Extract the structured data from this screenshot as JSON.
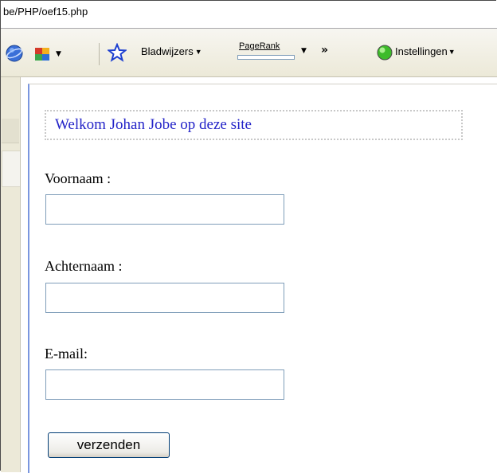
{
  "address_bar": {
    "url": "be/PHP/oef15.php"
  },
  "toolbar": {
    "bookmarks_label": "Bladwijzers",
    "pagerank_label": "PageRank",
    "more_label": "»",
    "settings_label": "Instellingen",
    "dropdown_glyph": "▼"
  },
  "form": {
    "welcome_text": "Welkom Johan Jobe op deze site",
    "first_name_label": "Voornaam :",
    "first_name_value": "",
    "last_name_label": "Achternaam :",
    "last_name_value": "",
    "email_label": "E-mail:",
    "email_value": "",
    "submit_label": "verzenden"
  },
  "icons": {
    "globe": "globe-icon",
    "puzzle": "puzzle-icon",
    "star": "star-icon",
    "status": "green-status-icon"
  },
  "colors": {
    "welcome_text": "#2323c8",
    "input_border": "#7f9db9",
    "toolbar_bg": "#ece9d8"
  }
}
